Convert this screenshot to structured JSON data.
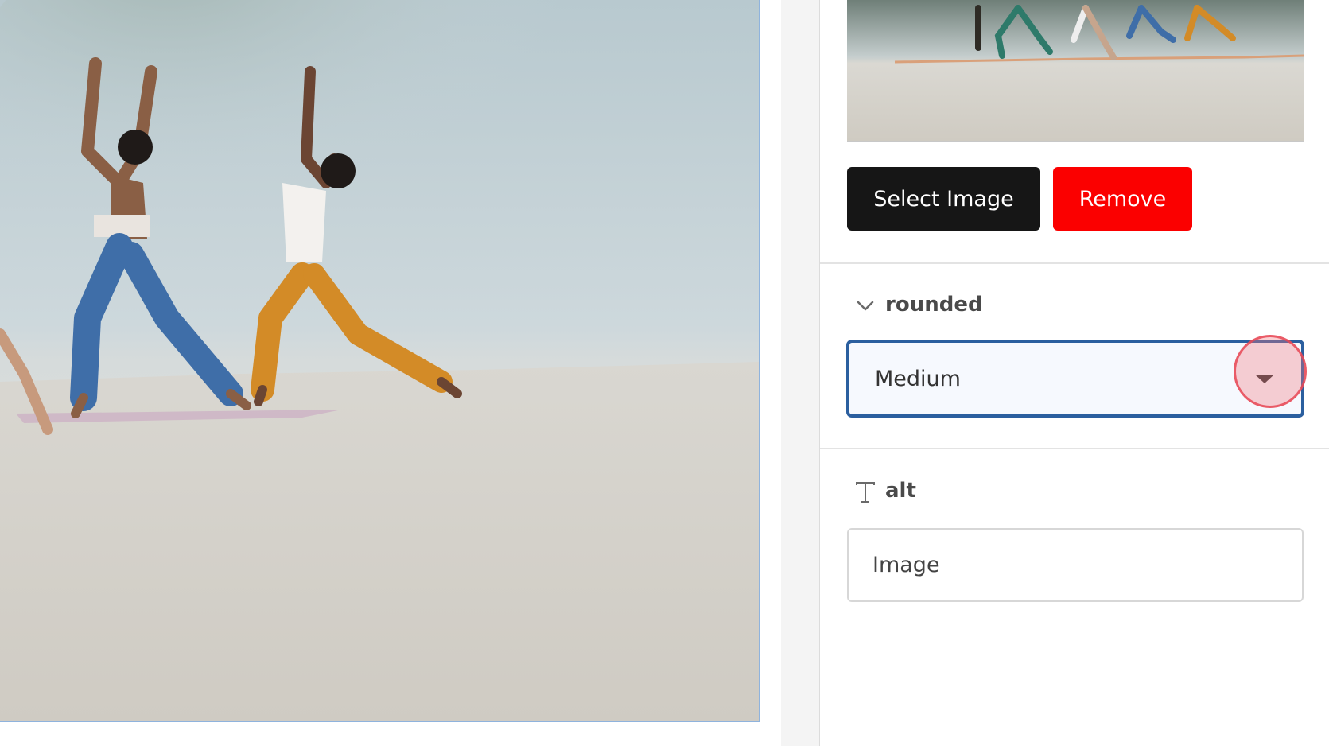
{
  "canvas": {
    "image_description_icon": "yoga-beach-photo"
  },
  "panel": {
    "thumbnail_icon": "yoga-beach-thumbnail",
    "buttons": {
      "select_image": "Select Image",
      "remove": "Remove"
    },
    "rounded": {
      "label": "rounded",
      "icon": "chevron-down-icon",
      "selected_value": "Medium"
    },
    "alt": {
      "label": "alt",
      "icon": "text-type-icon",
      "value": "Image"
    }
  },
  "colors": {
    "select_button": "#161616",
    "remove_button": "#fb0000",
    "select_border": "#2b5f9f",
    "canvas_border": "#8fb3dd"
  }
}
